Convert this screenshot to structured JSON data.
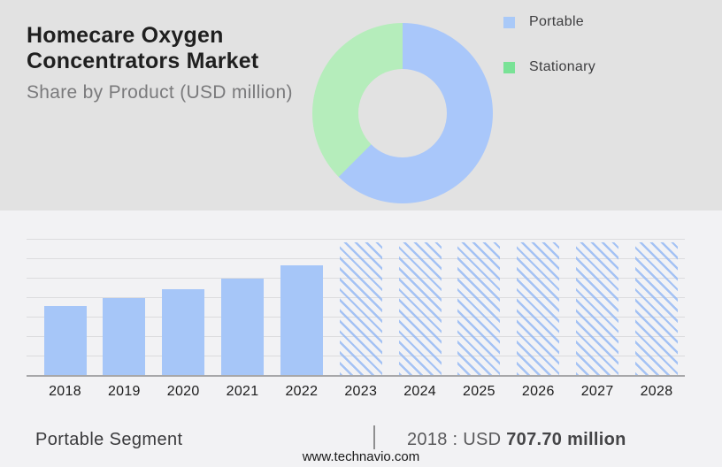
{
  "header": {
    "title_line1": "Homecare Oxygen",
    "title_line2": "Concentrators Market",
    "subtitle": "Share by Product (USD million)"
  },
  "legend": {
    "items": [
      {
        "label": "Portable",
        "swatch_color": "#a9c9f8"
      },
      {
        "label": "Stationary",
        "swatch_color": "#79e296"
      }
    ]
  },
  "chart_data": [
    {
      "type": "pie",
      "subtype": "donut",
      "title": "Share by Product (USD million)",
      "legend_position": "right",
      "segments": [
        {
          "label": "Portable",
          "percent": 62.5,
          "color": "#a9c7fa"
        },
        {
          "label": "Stationary",
          "percent": 37.5,
          "color": "#b5edbb"
        }
      ]
    },
    {
      "type": "bar",
      "categories": [
        "2018",
        "2019",
        "2020",
        "2021",
        "2022",
        "2023",
        "2024",
        "2025",
        "2026",
        "2027",
        "2028"
      ],
      "series": [
        {
          "name": "Portable",
          "values": [
            707.7,
            789,
            880,
            989,
            1125,
            null,
            null,
            null,
            null,
            null,
            null
          ],
          "note": "2018 value shown in footer; 2019-2022 estimated from bar heights; 2023-2028 are hatched forecast placeholders of equal height"
        }
      ],
      "bars": [
        {
          "year": "2018",
          "height_pct": 50.6,
          "style": "solid"
        },
        {
          "year": "2019",
          "height_pct": 56.5,
          "style": "solid"
        },
        {
          "year": "2020",
          "height_pct": 63.0,
          "style": "solid"
        },
        {
          "year": "2021",
          "height_pct": 70.8,
          "style": "solid"
        },
        {
          "year": "2022",
          "height_pct": 80.5,
          "style": "solid"
        },
        {
          "year": "2023",
          "height_pct": 97.4,
          "style": "hatched"
        },
        {
          "year": "2024",
          "height_pct": 97.4,
          "style": "hatched"
        },
        {
          "year": "2025",
          "height_pct": 97.4,
          "style": "hatched"
        },
        {
          "year": "2026",
          "height_pct": 97.4,
          "style": "hatched"
        },
        {
          "year": "2027",
          "height_pct": 97.4,
          "style": "hatched"
        },
        {
          "year": "2028",
          "height_pct": 97.4,
          "style": "hatched"
        }
      ],
      "grid": true,
      "gridline_count": 7,
      "y_axis_labels": false,
      "xlabel": "",
      "ylabel": ""
    }
  ],
  "footer": {
    "segment_label": "Portable Segment",
    "divider": "|",
    "value_prefix": "2018 : USD ",
    "value_bold": "707.70 million",
    "website": "www.technavio.com"
  },
  "colors": {
    "top_background": "#e2e2e2",
    "bottom_background": "#f2f2f4",
    "bar_blue": "#a6c6f8",
    "donut_blue": "#a9c7fa",
    "donut_green": "#b5edbb",
    "legend_green": "#79e296",
    "gridline": "#dcdcde",
    "axis_line": "#a7a7a9",
    "title_text": "#1f1f1f",
    "subtitle_text": "#7a7a7c"
  }
}
